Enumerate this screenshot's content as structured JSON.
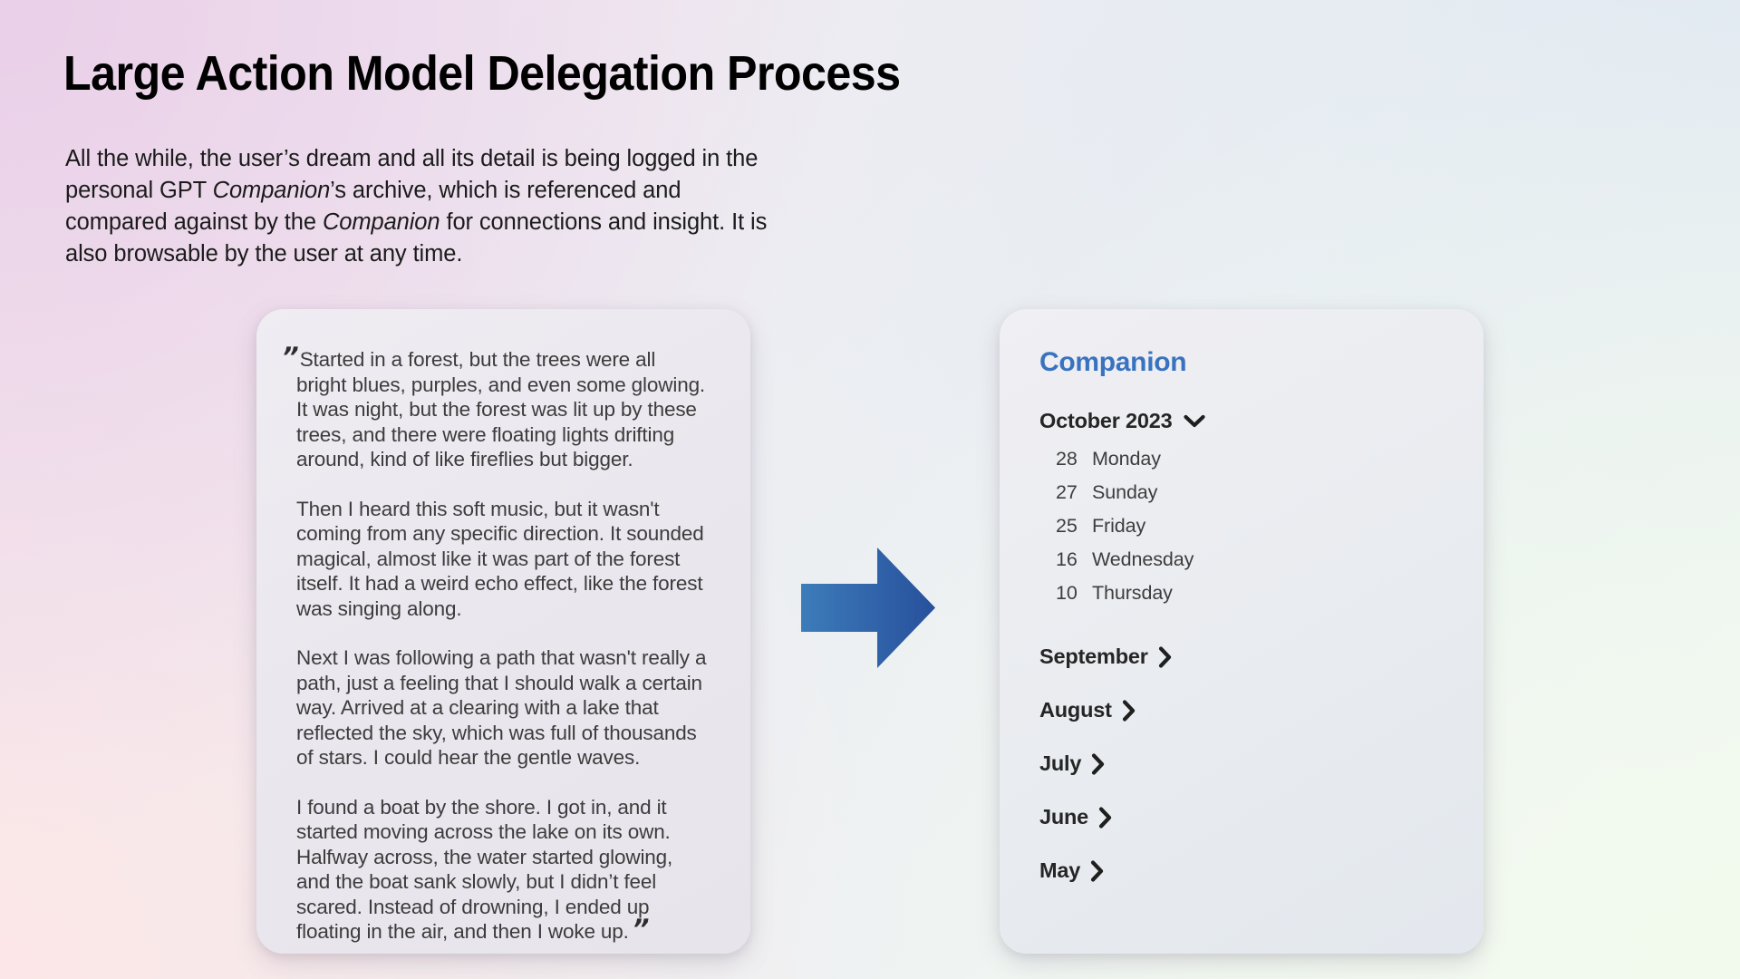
{
  "title": "Large Action Model Delegation Process",
  "intro": {
    "part1": "All the while, the user’s dream and all its detail is being logged in the personal GPT ",
    "em1": "Companion",
    "part2": "’s archive, which is referenced and compared against by the ",
    "em2": "Companion",
    "part3": " for connections and insight. It is also browsable by the user at any time."
  },
  "dream_card": {
    "quote_open": "”",
    "quote_close": "”",
    "paragraphs": [
      "Started in a forest, but the trees were all bright blues, purples, and even some glowing. It was night, but the forest was lit up by these trees, and there were floating lights drifting around, kind of like fireflies but bigger.",
      "Then I heard this soft music, but it wasn't coming from any specific direction. It sounded magical, almost like it was part of the forest itself. It had a weird echo effect, like the forest was singing along.",
      "Next I was following a path that wasn't really a path, just a feeling that I should walk a certain way. Arrived at a clearing with a lake that reflected the sky, which was full of thousands of stars. I could hear the gentle waves.",
      "I found a boat by the shore. I got in, and it started moving across the lake on its own. Halfway across, the water started glowing, and the boat sank slowly, but I didn’t feel scared. Instead of drowning, I ended up floating in the air, and then I woke up."
    ]
  },
  "companion": {
    "title": "Companion",
    "current_month": "October 2023",
    "days": [
      {
        "num": "28",
        "name": "Monday"
      },
      {
        "num": "27",
        "name": "Sunday"
      },
      {
        "num": "25",
        "name": "Friday"
      },
      {
        "num": "16",
        "name": "Wednesday"
      },
      {
        "num": "10",
        "name": "Thursday"
      }
    ],
    "months": [
      {
        "label": "September"
      },
      {
        "label": "August"
      },
      {
        "label": "July"
      },
      {
        "label": "June"
      },
      {
        "label": "May"
      }
    ]
  },
  "arrow": {
    "icon": "arrow-right-icon",
    "color_start": "#3d7cba",
    "color_end": "#27509c"
  },
  "colors": {
    "accent_blue": "#3973bf",
    "title_text": "#000000",
    "body_text": "#3c3c3c",
    "card_dream_bg": "#ebe8ef",
    "card_companion_bg": "#e9ecf0"
  }
}
